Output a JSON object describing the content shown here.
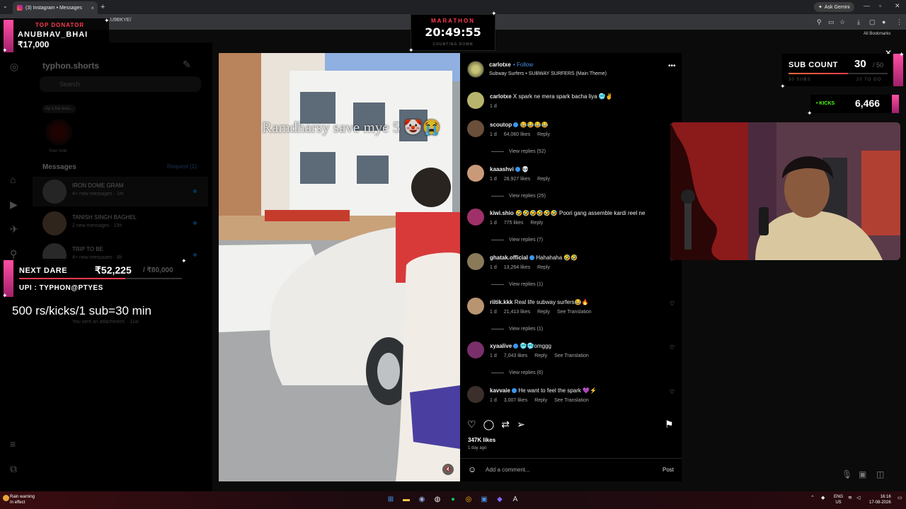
{
  "browser": {
    "tab_title": "(3) Instagram • Messages",
    "new_tab": "+",
    "url": "...U9BKYE/",
    "ask_gemini": "Ask Gemini",
    "all_bookmarks": "All Bookmarks"
  },
  "instagram": {
    "username": "typhon.shorts",
    "search_placeholder": "Search",
    "note_bubble": "Ay a kai lasa...",
    "note_label": "Your note",
    "messages_header": "Messages",
    "requests": "Request (1)",
    "conversations": [
      {
        "name": "IRON DOME GRAM",
        "preview": "4+ new messages · 1m"
      },
      {
        "name": "TANISH SINGH BAGHEL",
        "preview": "2 new messages · 19h"
      },
      {
        "name": "TRIP TO BE",
        "preview": "4+ new messages · 8h"
      }
    ],
    "attachment_preview": "You sent an attachment. · 11w"
  },
  "post": {
    "author": "carlotxe",
    "follow": "Follow",
    "audio": "Subway Surfers • SUBWAY SURFERS (Main Theme)",
    "video_caption": "Ramdharsy save mye 5 🤡😭",
    "likes": "347K likes",
    "posted": "1 day ago",
    "add_comment_placeholder": "Add a comment...",
    "post_button": "Post",
    "comments": [
      {
        "user": "carlotxe",
        "text": "X spark ne mera spark bacha liya 🥶✌️",
        "time": "1 d",
        "likes": "",
        "reply": "",
        "translate": "",
        "view_replies": "",
        "verified": false,
        "avatar_color": "#b9b46d"
      },
      {
        "user": "scoutop",
        "text": "😂😂😂😂",
        "time": "1 d",
        "likes": "64,060 likes",
        "reply": "Reply",
        "translate": "",
        "view_replies": "View replies (52)",
        "verified": true,
        "avatar_color": "#6a4f3b"
      },
      {
        "user": "kaaashvi",
        "text": "💀",
        "time": "1 d",
        "likes": "28,927 likes",
        "reply": "Reply",
        "translate": "",
        "view_replies": "View replies (25)",
        "verified": true,
        "avatar_color": "#c99a7a"
      },
      {
        "user": "kiwi.shio",
        "text": "🤣🤣🤣🤣🤣🤣 Poori gang assemble kardi reel ne",
        "time": "1 d",
        "likes": "775 likes",
        "reply": "Reply",
        "translate": "",
        "view_replies": "View replies (7)",
        "verified": false,
        "avatar_color": "#a0306a"
      },
      {
        "user": "ghatak.official",
        "text": "Hahahaha 🤣🤣",
        "time": "1 d",
        "likes": "13,264 likes",
        "reply": "Reply",
        "translate": "",
        "view_replies": "View replies (1)",
        "verified": true,
        "avatar_color": "#8a7a5a"
      },
      {
        "user": "riitik.kkk",
        "text": "Real life subway surfers😂🔥",
        "time": "1 d",
        "likes": "21,413 likes",
        "reply": "Reply",
        "translate": "See Translation",
        "view_replies": "View replies (1)",
        "verified": false,
        "avatar_color": "#b89470"
      },
      {
        "user": "xyaalive",
        "text": "🥶🥶omggg",
        "time": "1 d",
        "likes": "7,043 likes",
        "reply": "Reply",
        "translate": "See Translation",
        "view_replies": "View replies (6)",
        "verified": true,
        "avatar_color": "#7a2f6a"
      },
      {
        "user": "kavvaie",
        "text": "He want to feel the spark 💜⚡",
        "time": "1 d",
        "likes": "3,007 likes",
        "reply": "Reply",
        "translate": "See Translation",
        "view_replies": "",
        "verified": true,
        "avatar_color": "#3a2f2a"
      }
    ]
  },
  "overlays": {
    "top_donator_label": "TOP DONATOR",
    "top_donator_name": "ANUBHAV_BHAI",
    "top_donator_amount": "₹17,000",
    "marathon_title": "MARATHON",
    "marathon_time": "20:49:55",
    "marathon_sub": "COUNTING DOWN",
    "sub_count_label": "SUB COUNT",
    "sub_count_value": "30",
    "sub_count_goal": "/ 50",
    "sub_count_fraction": 0.6,
    "sub_left": "30 SUBS",
    "sub_right": "20 TO GO",
    "kicks_label": "• KICKS",
    "kicks_value": "6,466",
    "next_dare_label": "NEXT DARE",
    "next_dare_amount": "₹52,225",
    "next_dare_goal": "/ ₹80,000",
    "next_dare_fraction": 0.65,
    "upi": "UPI : TYPHON@PTYES",
    "rate": "500 rs/kicks/1 sub=30 min"
  },
  "taskbar": {
    "weather_title": "Rain warning",
    "weather_sub": "In effect",
    "lang_top": "ENG",
    "lang_bottom": "US",
    "time": "16:16",
    "date": "17-08-2026"
  }
}
